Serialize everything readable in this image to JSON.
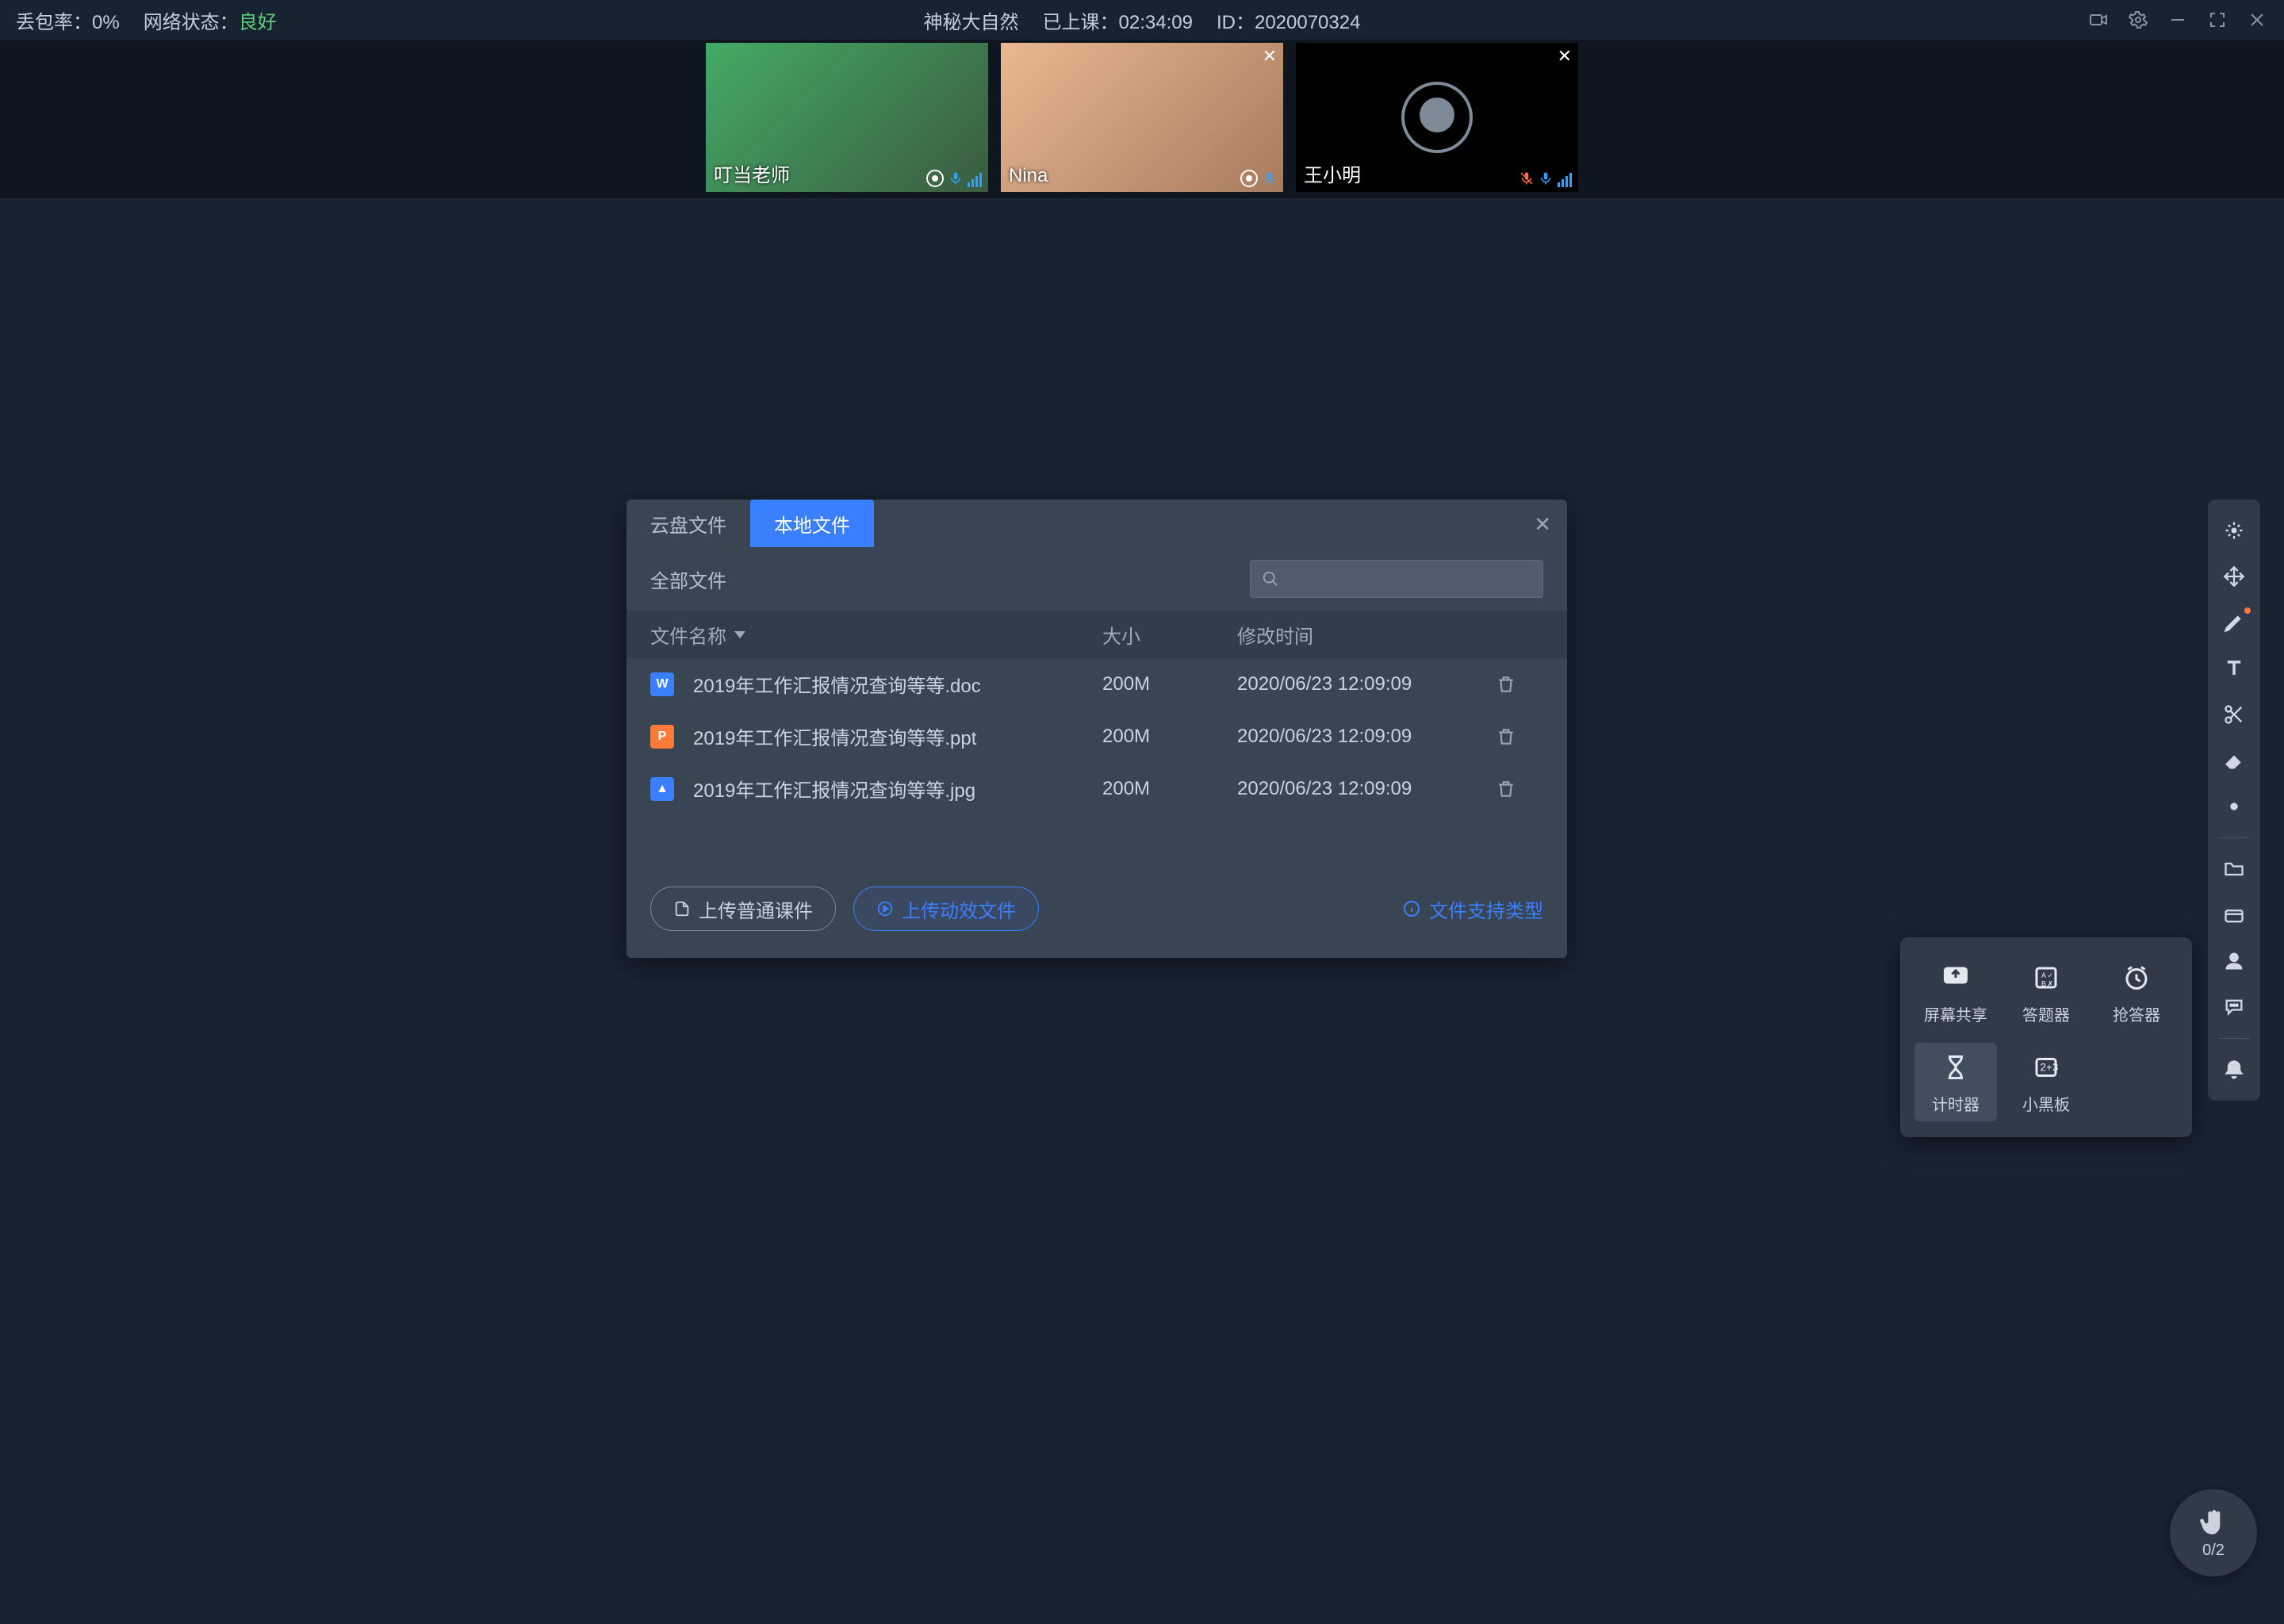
{
  "topbar": {
    "loss_label": "丢包率：",
    "loss_value": "0%",
    "net_label": "网络状态：",
    "net_value": "良好",
    "title": "神秘大自然",
    "elapsed_label": "已上课：",
    "elapsed_value": "02:34:09",
    "id_label": "ID：",
    "id_value": "2020070324"
  },
  "videos": [
    {
      "name": "叮当老师",
      "camera_off": false,
      "closable": false,
      "mic_muted": false
    },
    {
      "name": "Nina",
      "camera_off": false,
      "closable": true,
      "mic_muted": false
    },
    {
      "name": "王小明",
      "camera_off": true,
      "closable": true,
      "mic_muted": true
    }
  ],
  "dialog": {
    "tabs": [
      "云盘文件",
      "本地文件"
    ],
    "active_tab": 1,
    "scope": "全部文件",
    "columns": {
      "name": "文件名称",
      "size": "大小",
      "time": "修改时间"
    },
    "rows": [
      {
        "icon": "W",
        "cls": "ico-doc",
        "name": "2019年工作汇报情况查询等等.doc",
        "size": "200M",
        "time": "2020/06/23 12:09:09"
      },
      {
        "icon": "P",
        "cls": "ico-ppt",
        "name": "2019年工作汇报情况查询等等.ppt",
        "size": "200M",
        "time": "2020/06/23 12:09:09"
      },
      {
        "icon": "▲",
        "cls": "ico-jpg",
        "name": "2019年工作汇报情况查询等等.jpg",
        "size": "200M",
        "time": "2020/06/23 12:09:09"
      }
    ],
    "btn_upload_normal": "上传普通课件",
    "btn_upload_anim": "上传动效文件",
    "link_types": "文件支持类型"
  },
  "popover": {
    "items": [
      {
        "label": "屏幕共享"
      },
      {
        "label": "答题器"
      },
      {
        "label": "抢答器"
      },
      {
        "label": "计时器",
        "active": true
      },
      {
        "label": "小黑板"
      }
    ]
  },
  "hand": {
    "count": "0/2"
  }
}
